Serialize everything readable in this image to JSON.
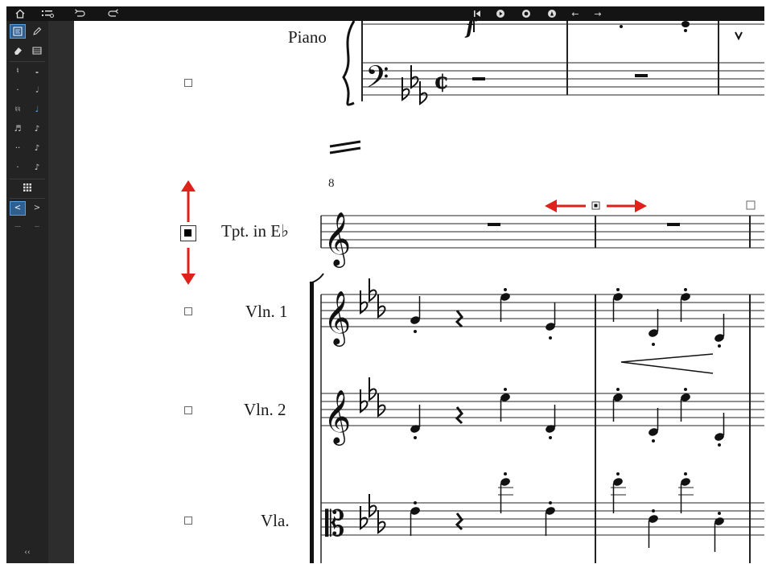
{
  "toolbar": {
    "home_icon": "home-icon",
    "parts_icon": "parts-list-icon",
    "undo_icon": "undo-icon",
    "redo_icon": "redo-icon",
    "rewind_icon": "rewind-icon",
    "play_icon": "play-icon",
    "record_icon": "record-icon",
    "metronome_icon": "metronome-icon",
    "left_arrow": "←",
    "right_arrow": "→"
  },
  "palette": {
    "tools": [
      "select-tool",
      "pencil-tool",
      "eraser-tool",
      "keyboard-tool"
    ],
    "bottom_label": "‹‹"
  },
  "score": {
    "instruments": [
      {
        "label": "Piano",
        "selected": false
      },
      {
        "label": "Tpt. in E♭",
        "selected": true
      },
      {
        "label": "Vln. 1",
        "selected": false
      },
      {
        "label": "Vln. 2",
        "selected": false
      },
      {
        "label": "Vla.",
        "selected": false
      }
    ],
    "measure_number": "8",
    "key_signature_flats": 3,
    "time_signature": "¢",
    "accent_color": "#e0201a",
    "selection_color": "#000000"
  }
}
